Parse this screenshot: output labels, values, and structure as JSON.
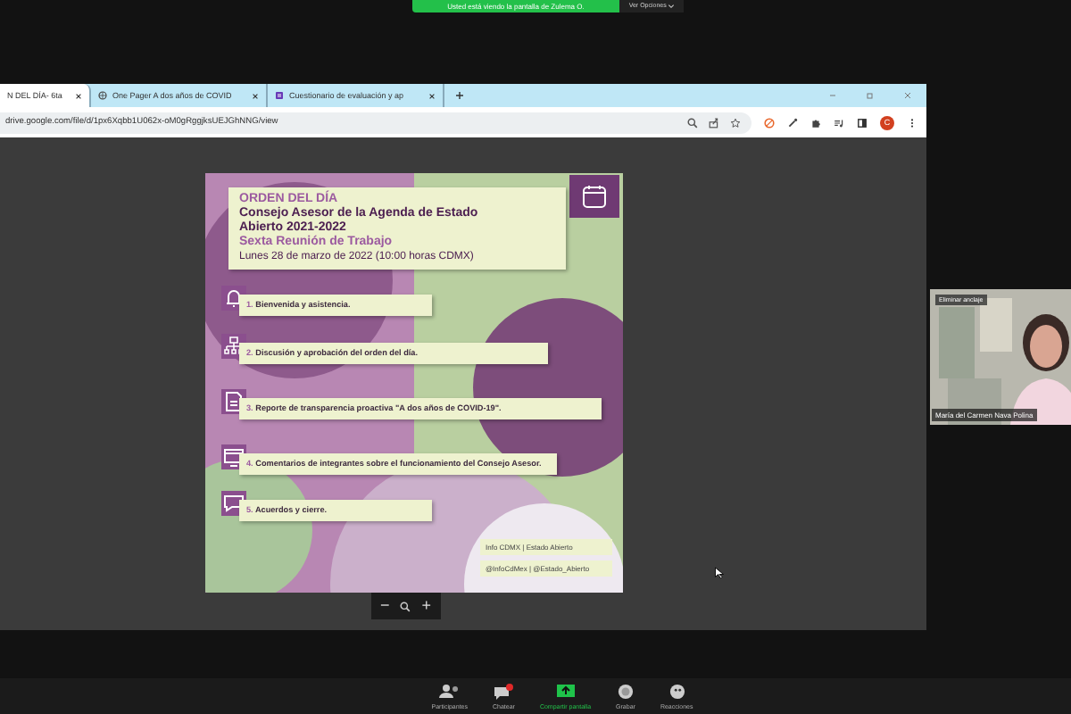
{
  "share_banner": {
    "text": "Usted está viendo la pantalla de Zulema O.",
    "options": "Ver Opciones"
  },
  "browser": {
    "tabs": [
      {
        "label": "N DEL DÍA- 6ta",
        "selected": true
      },
      {
        "label": "One Pager A dos años de COVID",
        "selected": false
      },
      {
        "label": "Cuestionario de evaluación y ap",
        "selected": false
      }
    ],
    "url": "drive.google.com/file/d/1px6Xqbb1U062x-oM0gRggjksUEJGhNNG/view",
    "profile": "C"
  },
  "slide": {
    "heading": "ORDEN DEL DÍA",
    "title": "Consejo Asesor de la Agenda de Estado Abierto 2021-2022",
    "subtitle": "Sexta Reunión de Trabajo",
    "date": "Lunes 28 de marzo de 2022 (10:00 horas CDMX)",
    "items": [
      {
        "number": "1.",
        "text": "Bienvenida y asistencia."
      },
      {
        "number": "2.",
        "text": "Discusión y aprobación del orden del día."
      },
      {
        "number": "3.",
        "text": "Reporte de transparencia proactiva \"A dos años de COVID-19\"."
      },
      {
        "number": "4.",
        "text": "Comentarios de integrantes sobre el funcionamiento del Consejo Asesor."
      },
      {
        "number": "5.",
        "text": "Acuerdos y cierre."
      }
    ],
    "social": [
      "Info CDMX | Estado Abierto",
      "@InfoCdMex | @Estado_Abierto"
    ]
  },
  "zoom_controls": [
    "−",
    "+"
  ],
  "video": {
    "label": "Eliminar anclaje",
    "name": "María del Carmen Nava Polina"
  },
  "toolbar": [
    {
      "label": "Participantes",
      "active": false
    },
    {
      "label": "Chatear",
      "active": false
    },
    {
      "label": "Compartir pantalla",
      "active": true
    },
    {
      "label": "Grabar",
      "active": false
    },
    {
      "label": "Reacciones",
      "active": false
    }
  ]
}
